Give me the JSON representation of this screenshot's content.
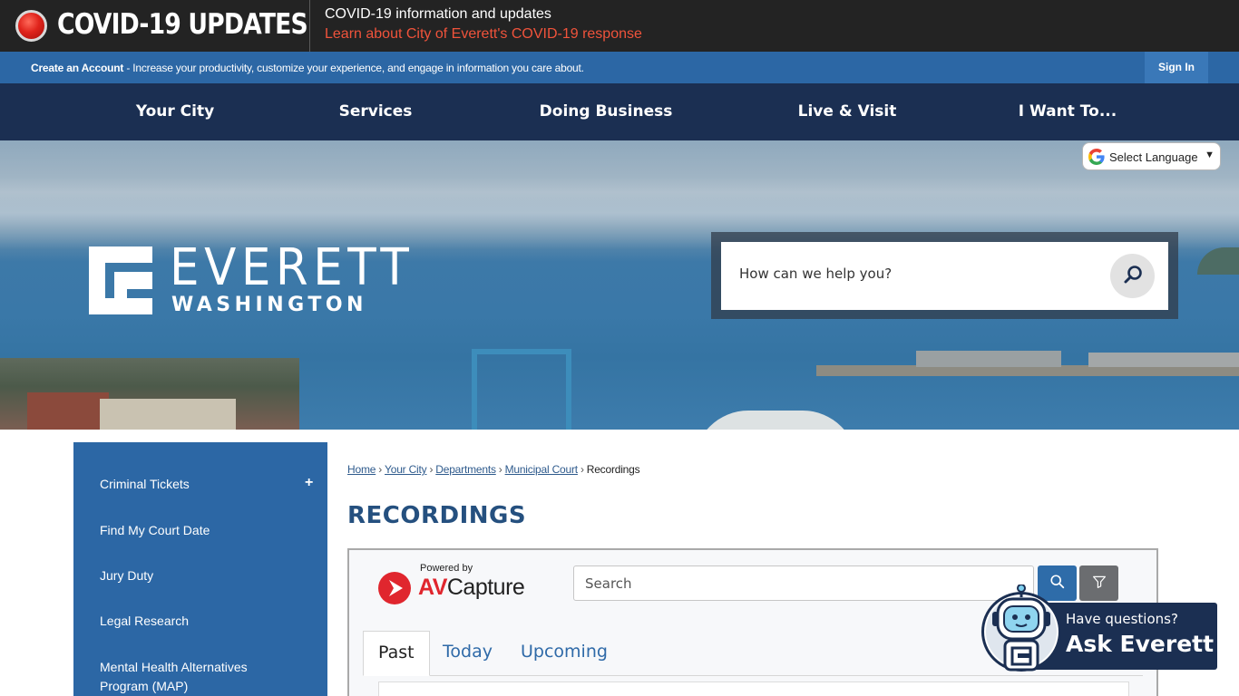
{
  "covid": {
    "title": "COVID-19 UPDATES",
    "info": "COVID-19 information and updates",
    "link": "Learn about City of Everett's COVID-19 response"
  },
  "account_bar": {
    "create_label": "Create an Account",
    "create_desc": " - Increase your productivity, customize your experience, and engage in information you care about.",
    "signin": "Sign In"
  },
  "nav": {
    "items": [
      "Your City",
      "Services",
      "Doing Business",
      "Live & Visit",
      "I Want To..."
    ]
  },
  "language": {
    "label": "Select Language",
    "icon": "google-g-icon"
  },
  "logo": {
    "name": "EVERETT",
    "sub": "WASHINGTON"
  },
  "site_search": {
    "placeholder": "How can we help you?",
    "icon": "search-icon"
  },
  "sidebar": {
    "items": [
      "Criminal Tickets",
      "Find My Court Date",
      "Jury Duty",
      "Legal Research",
      "Mental Health Alternatives",
      "Program (MAP)"
    ],
    "expand_symbol": "+"
  },
  "breadcrumb": {
    "items": [
      "Home",
      "Your City",
      "Departments",
      "Municipal Court"
    ],
    "current": "Recordings",
    "separator": "›"
  },
  "page": {
    "title": "RECORDINGS"
  },
  "avcapture": {
    "powered_by": "Powered by",
    "brand_av": "AV",
    "brand_capture": "Capture",
    "search_placeholder": "Search",
    "tabs": [
      "Past",
      "Today",
      "Upcoming"
    ],
    "active_tab": "Past"
  },
  "chat": {
    "question": "Have questions?",
    "name": "Ask Everett"
  },
  "colors": {
    "covid_bg": "#232323",
    "covid_link": "#f0533b",
    "account_bar": "#2c67a5",
    "nav_bg": "#1b2f52",
    "title": "#25507f",
    "av_red": "#e0262e"
  }
}
